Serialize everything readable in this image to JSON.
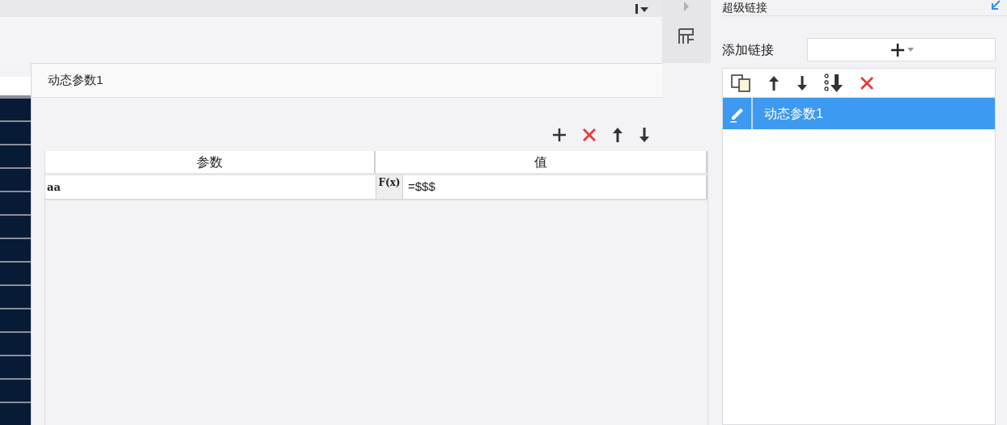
{
  "dialog": {
    "title": "动态参数1"
  },
  "table": {
    "columns": [
      "参数",
      "值"
    ],
    "rows": [
      {
        "name": "aa",
        "formula_button": "F(x)",
        "value": "=$$$"
      }
    ]
  },
  "hyperlink_panel": {
    "title": "超级链接",
    "add_label": "添加链接",
    "links": [
      {
        "label": "动态参数1",
        "selected": true
      }
    ]
  }
}
